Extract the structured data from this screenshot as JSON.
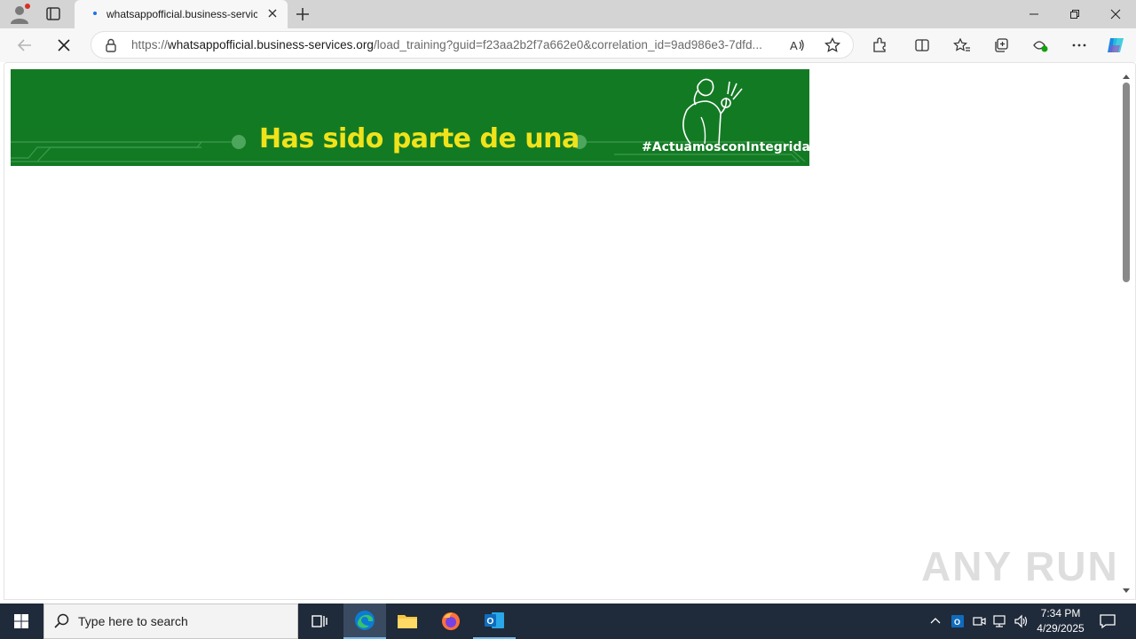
{
  "browser": {
    "tab_title": "whatsappofficial.business-services.org/load_training",
    "url_prefix": "https://",
    "url_domain": "whatsappofficial.business-services.org",
    "url_path": "/load_training?guid=f23aa2b2f7a662e0&correlation_id=9ad986e3-7dfd..."
  },
  "banner": {
    "headline": "Has sido parte de una",
    "hashtag": "#ActuamosconIntegridad",
    "bg_color": "#137a24",
    "headline_color": "#f0e31a"
  },
  "watermark": {
    "text": "ANY RUN"
  },
  "taskbar": {
    "search_placeholder": "Type here to search",
    "time": "7:34 PM",
    "date": "4/29/2025"
  }
}
